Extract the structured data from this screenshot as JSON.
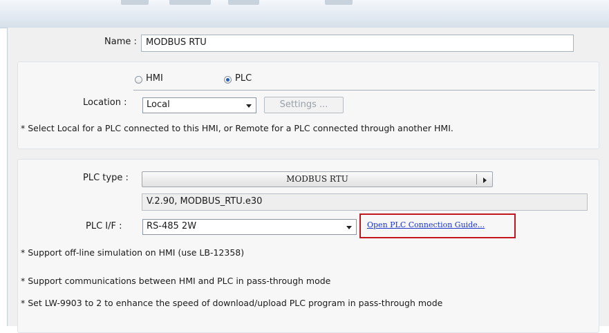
{
  "name_field": {
    "label": "Name :",
    "value": "MODBUS RTU"
  },
  "device_type": {
    "options": [
      {
        "label": "HMI",
        "selected": false
      },
      {
        "label": "PLC",
        "selected": true
      }
    ]
  },
  "location": {
    "label": "Location :",
    "value": "Local",
    "settings_button": "Settings ...",
    "note": "* Select Local for a PLC connected to this HMI, or Remote for a PLC connected through another HMI."
  },
  "plc": {
    "type_label": "PLC type :",
    "type_value": "MODBUS RTU",
    "version": "V.2.90, MODBUS_RTU.e30",
    "if_label": "PLC I/F :",
    "if_value": "RS-485 2W",
    "guide_link": "Open PLC Connection Guide...",
    "notes": [
      "* Support off-line simulation on HMI (use LB-12358)",
      "* Support communications between HMI and PLC in pass-through mode",
      "* Set LW-9903 to 2 to enhance the speed of download/upload PLC program in pass-through mode"
    ]
  },
  "colors": {
    "highlight": "#c0161e",
    "link": "#1a33c9",
    "radio_on": "#1f5fb8"
  }
}
